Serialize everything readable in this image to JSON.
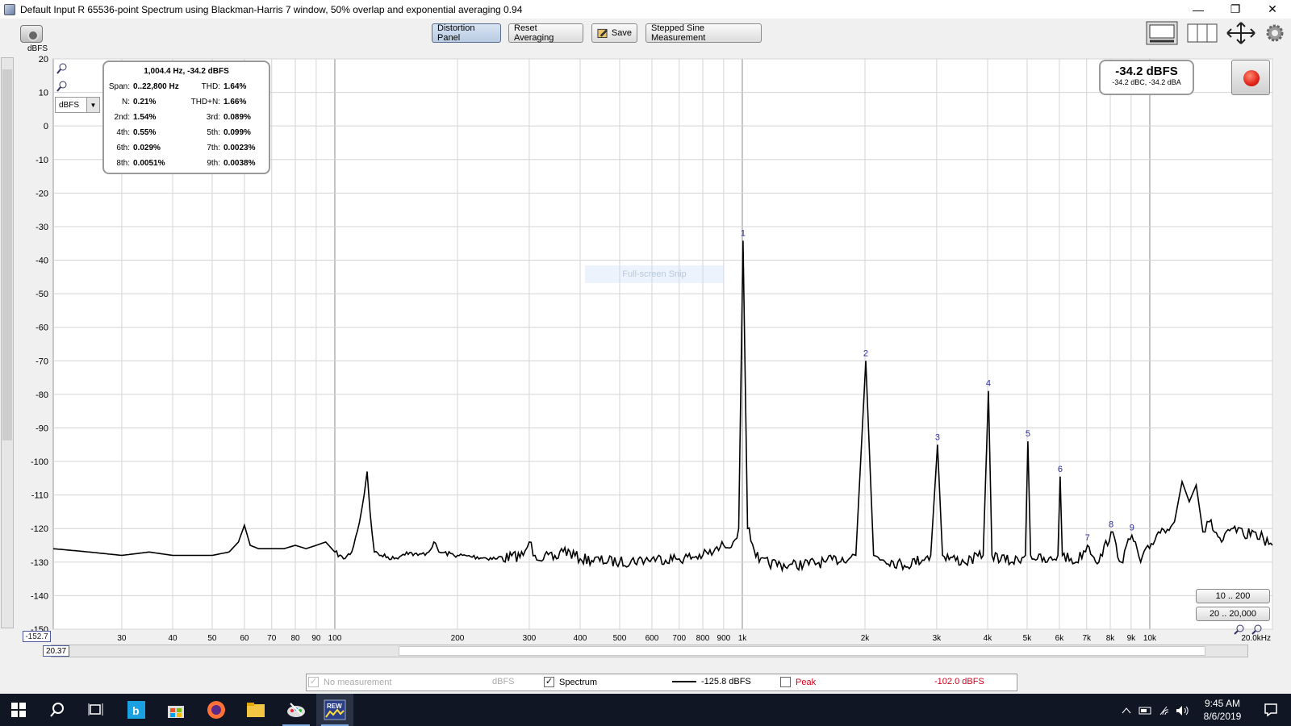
{
  "window": {
    "title": "Default Input R 65536-point Spectrum using Blackman-Harris 7 window, 50% overlap and exponential averaging 0.94",
    "minimize": "—",
    "restore": "❐",
    "close": "✕"
  },
  "toolbar": {
    "distortion_panel": "Distortion Panel",
    "reset_averaging": "Reset Averaging",
    "save": "Save",
    "stepped_sine": "Stepped Sine Measurement"
  },
  "graph": {
    "y_unit": "dBFS",
    "unit_select": "dBFS",
    "y_min_value": "-152.7",
    "x_start_value": "20.37",
    "watermark": "Full-screen Snip",
    "range_buttons": [
      "10 .. 200",
      "20 .. 20,000"
    ]
  },
  "distortion": {
    "header": "1,004.4 Hz, -34.2 dBFS",
    "rows": [
      {
        "l1": "Span:",
        "v1": "0..22,800 Hz",
        "l2": "THD:",
        "v2": "1.64%"
      },
      {
        "l1": "N:",
        "v1": "0.21%",
        "l2": "THD+N:",
        "v2": "1.66%"
      },
      {
        "l1": "2nd:",
        "v1": "1.54%",
        "l2": "3rd:",
        "v2": "0.089%"
      },
      {
        "l1": "4th:",
        "v1": "0.55%",
        "l2": "5th:",
        "v2": "0.099%"
      },
      {
        "l1": "6th:",
        "v1": "0.029%",
        "l2": "7th:",
        "v2": "0.0023%"
      },
      {
        "l1": "8th:",
        "v1": "0.0051%",
        "l2": "9th:",
        "v2": "0.0038%"
      }
    ]
  },
  "level": {
    "main": "-34.2 dBFS",
    "sub": "-34.2 dBC, -34.2 dBA"
  },
  "legend": {
    "no_measurement": "No measurement",
    "no_measurement_unit": "dBFS",
    "spectrum": "Spectrum",
    "spectrum_value": "-125.8 dBFS",
    "peak": "Peak",
    "peak_value": "-102.0 dBFS",
    "spectrum_color": "#000000",
    "peak_color": "#d0021b"
  },
  "taskbar": {
    "time": "9:45 AM",
    "date": "8/6/2019",
    "rew_label": "REW"
  },
  "chart_data": {
    "type": "line",
    "x_scale": "log",
    "xlim": [
      20.37,
      20000
    ],
    "ylim": [
      -150,
      20
    ],
    "ylabel": "dBFS",
    "y_ticks": [
      "20",
      "10",
      "0",
      "-10",
      "-20",
      "-30",
      "-40",
      "-50",
      "-60",
      "-70",
      "-80",
      "-90",
      "-100",
      "-110",
      "-120",
      "-130",
      "-140",
      "-150"
    ],
    "x_ticks": [
      {
        "f": 30,
        "label": "30"
      },
      {
        "f": 40,
        "label": "40"
      },
      {
        "f": 50,
        "label": "50"
      },
      {
        "f": 60,
        "label": "60"
      },
      {
        "f": 70,
        "label": "70"
      },
      {
        "f": 80,
        "label": "80"
      },
      {
        "f": 90,
        "label": "90"
      },
      {
        "f": 100,
        "label": "100"
      },
      {
        "f": 200,
        "label": "200"
      },
      {
        "f": 300,
        "label": "300"
      },
      {
        "f": 400,
        "label": "400"
      },
      {
        "f": 500,
        "label": "500"
      },
      {
        "f": 600,
        "label": "600"
      },
      {
        "f": 700,
        "label": "700"
      },
      {
        "f": 800,
        "label": "800"
      },
      {
        "f": 900,
        "label": "900"
      },
      {
        "f": 1000,
        "label": "1k"
      },
      {
        "f": 2000,
        "label": "2k"
      },
      {
        "f": 3000,
        "label": "3k"
      },
      {
        "f": 4000,
        "label": "4k"
      },
      {
        "f": 5000,
        "label": "5k"
      },
      {
        "f": 6000,
        "label": "6k"
      },
      {
        "f": 7000,
        "label": "7k"
      },
      {
        "f": 8000,
        "label": "8k"
      },
      {
        "f": 9000,
        "label": "9k"
      },
      {
        "f": 10000,
        "label": "10k"
      },
      {
        "f": 20000,
        "label": "20.0kHz"
      }
    ],
    "harmonic_markers": [
      {
        "label": "1",
        "f": 1004.4,
        "db": -34.2
      },
      {
        "label": "2",
        "f": 2008.8,
        "db": -70
      },
      {
        "label": "3",
        "f": 3013.2,
        "db": -95
      },
      {
        "label": "4",
        "f": 4017.6,
        "db": -79
      },
      {
        "label": "5",
        "f": 5022,
        "db": -94
      },
      {
        "label": "6",
        "f": 6026.4,
        "db": -104.5
      },
      {
        "label": "7",
        "f": 7030.8,
        "db": -125
      },
      {
        "label": "8",
        "f": 8035.2,
        "db": -121
      },
      {
        "label": "9",
        "f": 9039.6,
        "db": -122
      }
    ],
    "series": [
      {
        "color": "#000000",
        "x": [
          20.37,
          25,
          30,
          35,
          40,
          45,
          50,
          55,
          58,
          60,
          62,
          65,
          70,
          75,
          80,
          85,
          90,
          95,
          100,
          105,
          110,
          115,
          118,
          120,
          122,
          125,
          130,
          140,
          150,
          160,
          170,
          175,
          180,
          200,
          250,
          290,
          300,
          310,
          350,
          360,
          400,
          500,
          600,
          700,
          800,
          850,
          900,
          950,
          980,
          1004.4,
          1030,
          1100,
          1300,
          1600,
          1900,
          2008.8,
          2100,
          2500,
          2900,
          3013.2,
          3100,
          3500,
          3900,
          4017.6,
          4100,
          4600,
          4950,
          5022,
          5100,
          5600,
          5950,
          6026.4,
          6100,
          6600,
          7030.8,
          7500,
          8035.2,
          8500,
          9039.6,
          9500,
          10500,
          11500,
          12000,
          12500,
          13000,
          13500,
          14000,
          15000,
          16000,
          17000,
          18000,
          19000,
          20000
        ],
        "y": [
          -126,
          -127,
          -128,
          -127,
          -128,
          -128,
          -128,
          -127,
          -124,
          -119,
          -125,
          -126,
          -126,
          -126,
          -125,
          -126,
          -125,
          -124,
          -127,
          -129,
          -127,
          -118,
          -110,
          -103,
          -115,
          -127,
          -128,
          -129,
          -127,
          -128,
          -127,
          -124,
          -127,
          -128,
          -129,
          -128,
          -124,
          -128,
          -129,
          -126,
          -129,
          -130,
          -129,
          -129,
          -128,
          -127,
          -125,
          -124,
          -120,
          -34.2,
          -120,
          -130,
          -131,
          -130,
          -128,
          -70,
          -128,
          -131,
          -128,
          -95,
          -128,
          -130,
          -128,
          -79,
          -128,
          -130,
          -128,
          -94,
          -128,
          -130,
          -128,
          -104.5,
          -128,
          -130,
          -125,
          -130,
          -121,
          -130,
          -122,
          -130,
          -121,
          -118,
          -106,
          -112,
          -107,
          -121,
          -118,
          -124,
          -120,
          -122,
          -121,
          -123,
          -125
        ]
      }
    ]
  }
}
